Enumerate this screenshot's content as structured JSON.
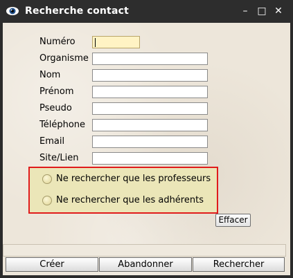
{
  "window": {
    "title": "Recherche contact",
    "buttons": {
      "minimize": "–",
      "maximize": "□",
      "close": "✕"
    }
  },
  "form": {
    "fields": [
      {
        "label": "Numéro",
        "value": ""
      },
      {
        "label": "Organisme",
        "value": ""
      },
      {
        "label": "Nom",
        "value": ""
      },
      {
        "label": "Prénom",
        "value": ""
      },
      {
        "label": "Pseudo",
        "value": ""
      },
      {
        "label": "Téléphone",
        "value": ""
      },
      {
        "label": "Email",
        "value": ""
      },
      {
        "label": "Site/Lien",
        "value": ""
      }
    ]
  },
  "filters": {
    "professeurs": "Ne rechercher que les professeurs",
    "adherents": "Ne rechercher que les adhérents"
  },
  "actions": {
    "clear": "Effacer",
    "create": "Créer",
    "cancel": "Abandonner",
    "search": "Rechercher"
  },
  "icons": {
    "app": "eye-icon"
  },
  "colors": {
    "highlight": "#e01b1b",
    "titlebar": "#2d2d2d",
    "active_field": "#fff3c4"
  }
}
